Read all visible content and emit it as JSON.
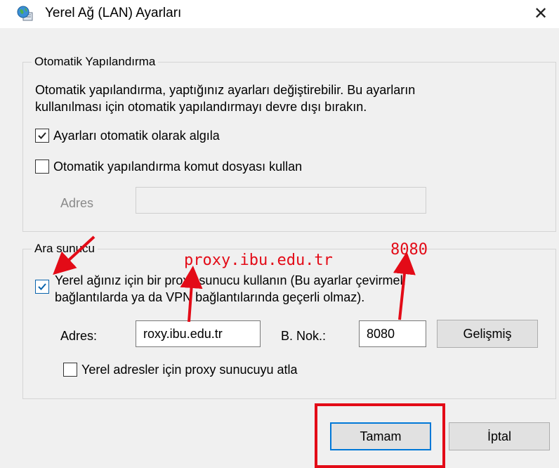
{
  "window": {
    "title": "Yerel Ağ (LAN) Ayarları",
    "close_symbol": "✕",
    "icon": "network-globe-icon"
  },
  "auto_config": {
    "legend": "Otomatik Yapılandırma",
    "description_line1": "Otomatik yapılandırma, yaptığınız ayarları değiştirebilir. Bu ayarların",
    "description_line2": "kullanılması için otomatik yapılandırmayı devre dışı bırakın.",
    "auto_detect": {
      "label": "Ayarları otomatik olarak algıla",
      "checked": true
    },
    "use_script": {
      "label": "Otomatik yapılandırma komut dosyası kullan",
      "checked": false
    },
    "address_label": "Adres",
    "address_value": ""
  },
  "proxy": {
    "legend": "Ara sunucu",
    "use_proxy": {
      "label_line1": "Yerel ağınız için bir proxy sunucu kullanın (Bu ayarlar çevirmeli",
      "label_line2": "bağlantılarda ya da VPN bağlantılarında geçerli olmaz).",
      "checked": true
    },
    "address_label": "Adres:",
    "address_value": "roxy.ibu.edu.tr",
    "port_label": "B. Nok.:",
    "port_value": "8080",
    "advanced_label": "Gelişmiş",
    "bypass_local": {
      "label": "Yerel adresler için proxy sunucuyu atla",
      "checked": false
    }
  },
  "buttons": {
    "ok_label": "Tamam",
    "cancel_label": "İptal"
  },
  "annotations": {
    "proxy_note": "proxy.ibu.edu.tr",
    "port_note": "8080",
    "color": "#e30b17"
  }
}
